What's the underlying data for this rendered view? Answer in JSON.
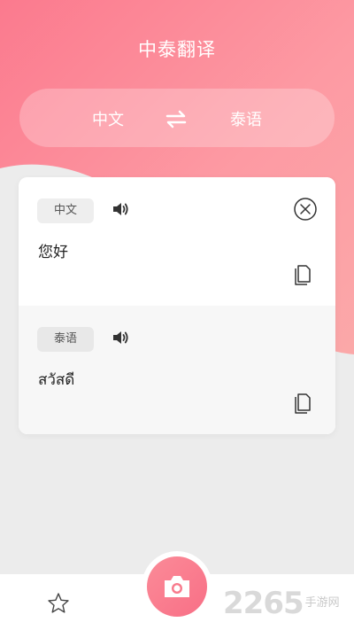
{
  "header": {
    "title": "中泰翻译"
  },
  "language_switch": {
    "source": "中文",
    "target": "泰语"
  },
  "source_panel": {
    "lang": "中文",
    "text": "您好"
  },
  "target_panel": {
    "lang": "泰语",
    "text": "สวัสดี"
  },
  "watermark": {
    "number": "2265",
    "text": "手游网"
  },
  "colors": {
    "primary": "#fb7a8e",
    "accent": "#f86f86"
  },
  "icons": {
    "swap": "swap-arrows-icon",
    "speaker": "speaker-icon",
    "clear": "close-circle-icon",
    "copy": "copy-icon",
    "favorite": "star-icon",
    "camera": "camera-icon"
  }
}
